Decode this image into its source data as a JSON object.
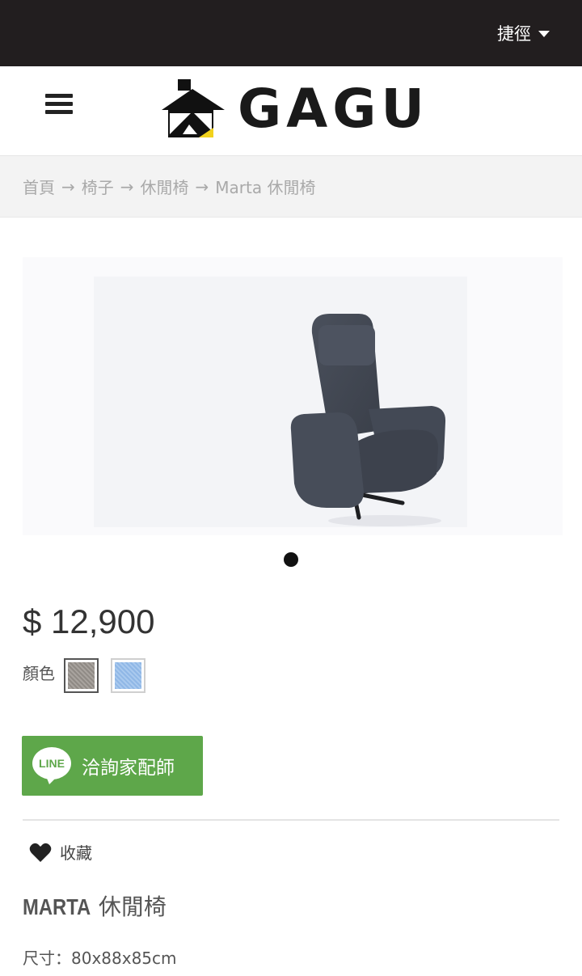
{
  "topbar": {
    "shortcut_label": "捷徑",
    "shortcut_icon": "caret-down-icon"
  },
  "header": {
    "menu_icon": "hamburger-menu-icon",
    "logo_text": "GAGU"
  },
  "breadcrumb": {
    "items": [
      "首頁",
      "椅子",
      "休閒椅",
      "Marta 休閒椅"
    ],
    "separator": "→"
  },
  "gallery": {
    "image": "gray-recliner-chair-photo",
    "active_slide": 1
  },
  "product": {
    "price": "$ 12,900",
    "color_label": "顏色",
    "colors": [
      {
        "name": "grey",
        "hex": "#9b968f",
        "selected": true
      },
      {
        "name": "light-blue",
        "hex": "#9cc0ea",
        "selected": false
      }
    ],
    "line_button": {
      "icon_text": "LINE",
      "label": "洽詢家配師",
      "color": "#5ea74a"
    },
    "favorite_label": "收藏",
    "title_en": "MARTA",
    "title_zh": "休閒椅",
    "dimensions": "尺寸：80x88x85cm"
  }
}
